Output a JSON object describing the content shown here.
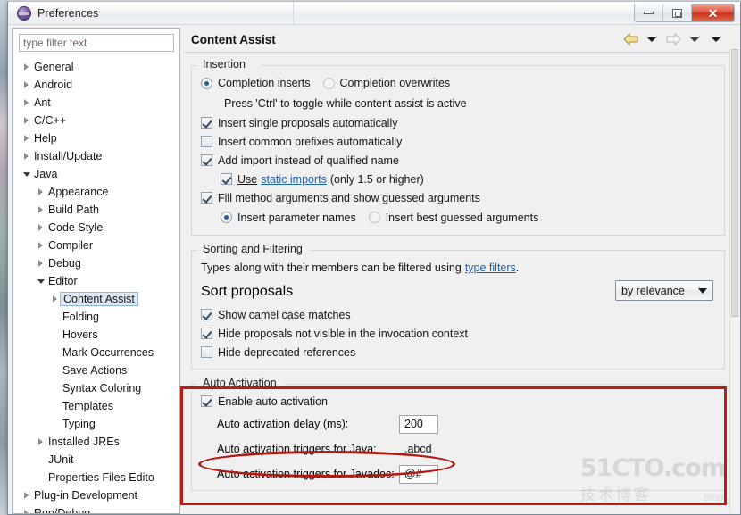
{
  "window": {
    "title": "Preferences",
    "icon": "eclipse-sphere-icon",
    "buttons": {
      "minimize": "Minimize",
      "maximize": "Maximize",
      "close": "Close"
    }
  },
  "sidebar": {
    "filter_placeholder": "type filter text",
    "filter_value": "",
    "items": [
      {
        "label": "General",
        "level": 0,
        "state": "collapsed"
      },
      {
        "label": "Android",
        "level": 0,
        "state": "collapsed"
      },
      {
        "label": "Ant",
        "level": 0,
        "state": "collapsed"
      },
      {
        "label": "C/C++",
        "level": 0,
        "state": "collapsed"
      },
      {
        "label": "Help",
        "level": 0,
        "state": "collapsed"
      },
      {
        "label": "Install/Update",
        "level": 0,
        "state": "collapsed"
      },
      {
        "label": "Java",
        "level": 0,
        "state": "expanded"
      },
      {
        "label": "Appearance",
        "level": 1,
        "state": "collapsed"
      },
      {
        "label": "Build Path",
        "level": 1,
        "state": "collapsed"
      },
      {
        "label": "Code Style",
        "level": 1,
        "state": "collapsed"
      },
      {
        "label": "Compiler",
        "level": 1,
        "state": "collapsed"
      },
      {
        "label": "Debug",
        "level": 1,
        "state": "collapsed"
      },
      {
        "label": "Editor",
        "level": 1,
        "state": "expanded"
      },
      {
        "label": "Content Assist",
        "level": 2,
        "state": "collapsed",
        "selected": true
      },
      {
        "label": "Folding",
        "level": 2,
        "state": "leaf"
      },
      {
        "label": "Hovers",
        "level": 2,
        "state": "leaf"
      },
      {
        "label": "Mark Occurrences",
        "level": 2,
        "state": "leaf"
      },
      {
        "label": "Save Actions",
        "level": 2,
        "state": "leaf"
      },
      {
        "label": "Syntax Coloring",
        "level": 2,
        "state": "leaf"
      },
      {
        "label": "Templates",
        "level": 2,
        "state": "leaf"
      },
      {
        "label": "Typing",
        "level": 2,
        "state": "leaf"
      },
      {
        "label": "Installed JREs",
        "level": 1,
        "state": "collapsed"
      },
      {
        "label": "JUnit",
        "level": 1,
        "state": "leaf"
      },
      {
        "label": "Properties Files Edito",
        "level": 1,
        "state": "leaf"
      },
      {
        "label": "Plug-in Development",
        "level": 0,
        "state": "collapsed"
      },
      {
        "label": "Run/Debug",
        "level": 0,
        "state": "collapsed"
      }
    ]
  },
  "page": {
    "title": "Content Assist",
    "nav": {
      "back": "back-arrow",
      "back_menu": "back-dropdown",
      "forward": "forward-arrow",
      "forward_menu": "forward-dropdown",
      "view_menu": "view-menu"
    }
  },
  "insertion": {
    "legend": "Insertion",
    "radio_inserts": "Completion inserts",
    "radio_overwrites": "Completion overwrites",
    "hint": "Press 'Ctrl' to toggle while content assist is active",
    "cb_single": "Insert single proposals automatically",
    "cb_prefixes": "Insert common prefixes automatically",
    "cb_add_import": "Add import instead of qualified name",
    "cb_static_use": "Use",
    "cb_static_link": "static imports",
    "cb_static_tail": "(only 1.5 or higher)",
    "cb_fill_args": "Fill method arguments and show guessed arguments",
    "radio_param_names": "Insert parameter names",
    "radio_best_guessed": "Insert best guessed arguments"
  },
  "sorting": {
    "legend": "Sorting and Filtering",
    "desc_pre": "Types along with their members can be filtered using",
    "desc_link": "type filters",
    "desc_post": ".",
    "sort_label": "Sort proposals",
    "sort_value": "by relevance",
    "cb_camel": "Show camel case matches",
    "cb_hide_invisible": "Hide proposals not visible in the invocation context",
    "cb_hide_deprecated": "Hide deprecated references"
  },
  "auto_activation": {
    "legend": "Auto Activation",
    "cb_enable": "Enable auto activation",
    "delay_label": "Auto activation delay (ms):",
    "delay_value": "200",
    "java_label": "Auto activation triggers for Java:",
    "java_value": ".abcd",
    "javadoc_label": "Auto activation triggers for Javadoc:",
    "javadoc_value": "@#"
  },
  "annotations": {
    "highlight_color": "#b81c13",
    "box_target": "Auto Activation group",
    "ellipse_target": "Auto activation triggers for Java row"
  },
  "watermark": {
    "main": "51CTO.com",
    "sub": "技术博客",
    "blog": "Blog"
  }
}
